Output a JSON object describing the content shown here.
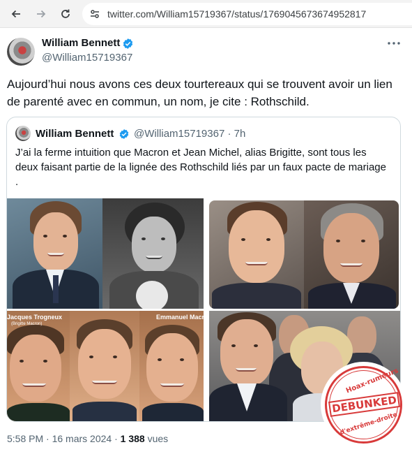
{
  "browser": {
    "url": "twitter.com/William15719367/status/1769045673674952817"
  },
  "tweet": {
    "author_name": "William Bennett",
    "author_handle": "@William15719367",
    "text": "Aujourd’hui nous avons ces deux tourtereaux qui se trouvent avoir un lien de parenté avec en commun, un nom, je cite : Rothschild.",
    "timestamp": "5:58 PM · 16 mars 2024 · ",
    "views_count": "1 388",
    "views_label": " vues"
  },
  "quote": {
    "author_name": "William Bennett",
    "author_handle": "@William15719367 · 7h",
    "text": "J’ai la ferme intuition que Macron et Jean Michel, alias Brigitte, sont tous les deux faisant partie de la lignée des Rothschild liés par un faux pacte de mariage ."
  },
  "media": {
    "caption_left": "Jacques Trogneux",
    "caption_left_sub": "(Brigitte Macron)",
    "caption_right": "Emmanuel Macr"
  },
  "stamp": {
    "top": "Hoax-rumeurs",
    "middle": "DEBUNKED",
    "bottom": "d'extrême-droite"
  },
  "colors": {
    "accent": "#1d9bf0",
    "stamp_red": "#d83a3a",
    "text_secondary": "#536471"
  },
  "icons": [
    "back-arrow-icon",
    "forward-arrow-icon",
    "reload-icon",
    "site-settings-icon",
    "verified-badge-icon",
    "more-options-icon"
  ]
}
